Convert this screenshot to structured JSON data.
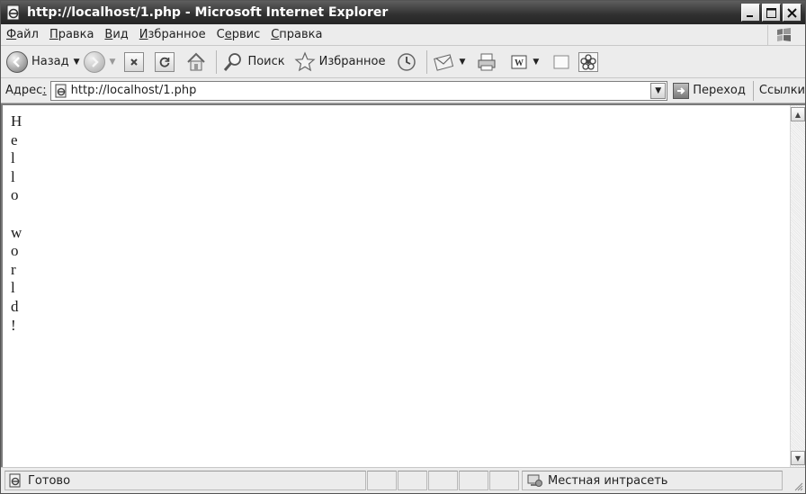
{
  "window": {
    "title": "http://localhost/1.php - Microsoft Internet Explorer"
  },
  "menu": {
    "items": [
      {
        "accel": "Ф",
        "rest": "айл"
      },
      {
        "accel": "П",
        "rest": "равка"
      },
      {
        "accel": "В",
        "rest": "ид"
      },
      {
        "accel": "И",
        "rest": "збранное"
      },
      {
        "pre": "С",
        "accel": "е",
        "rest": "рвис"
      },
      {
        "accel": "С",
        "rest": "правка"
      }
    ]
  },
  "toolbar": {
    "back_label": "Назад",
    "search_label": "Поиск",
    "favorites_label": "Избранное"
  },
  "address": {
    "label_main": "Адрес",
    "label_accel": ":",
    "url": "http://localhost/1.php",
    "go_label": "Переход",
    "links_label": "Ссылки"
  },
  "page": {
    "lines": [
      "H",
      "e",
      "l",
      "l",
      "o",
      "",
      "w",
      "o",
      "r",
      "l",
      "d",
      "!"
    ]
  },
  "status": {
    "text": "Готово",
    "zone": "Местная интрасеть"
  },
  "icons": {
    "window": "ie-page-icon",
    "back": "back-arrow-icon",
    "forward": "forward-arrow-icon",
    "stop": "stop-icon",
    "refresh": "refresh-icon",
    "home": "home-icon",
    "search": "magnifier-icon",
    "favorites": "star-icon",
    "history": "history-icon",
    "mail": "mail-icon",
    "print": "printer-icon",
    "edit": "word-edit-icon",
    "discuss": "discuss-icon",
    "messenger": "messenger-flower-icon",
    "go": "go-arrow-icon",
    "zone": "intranet-icon"
  }
}
